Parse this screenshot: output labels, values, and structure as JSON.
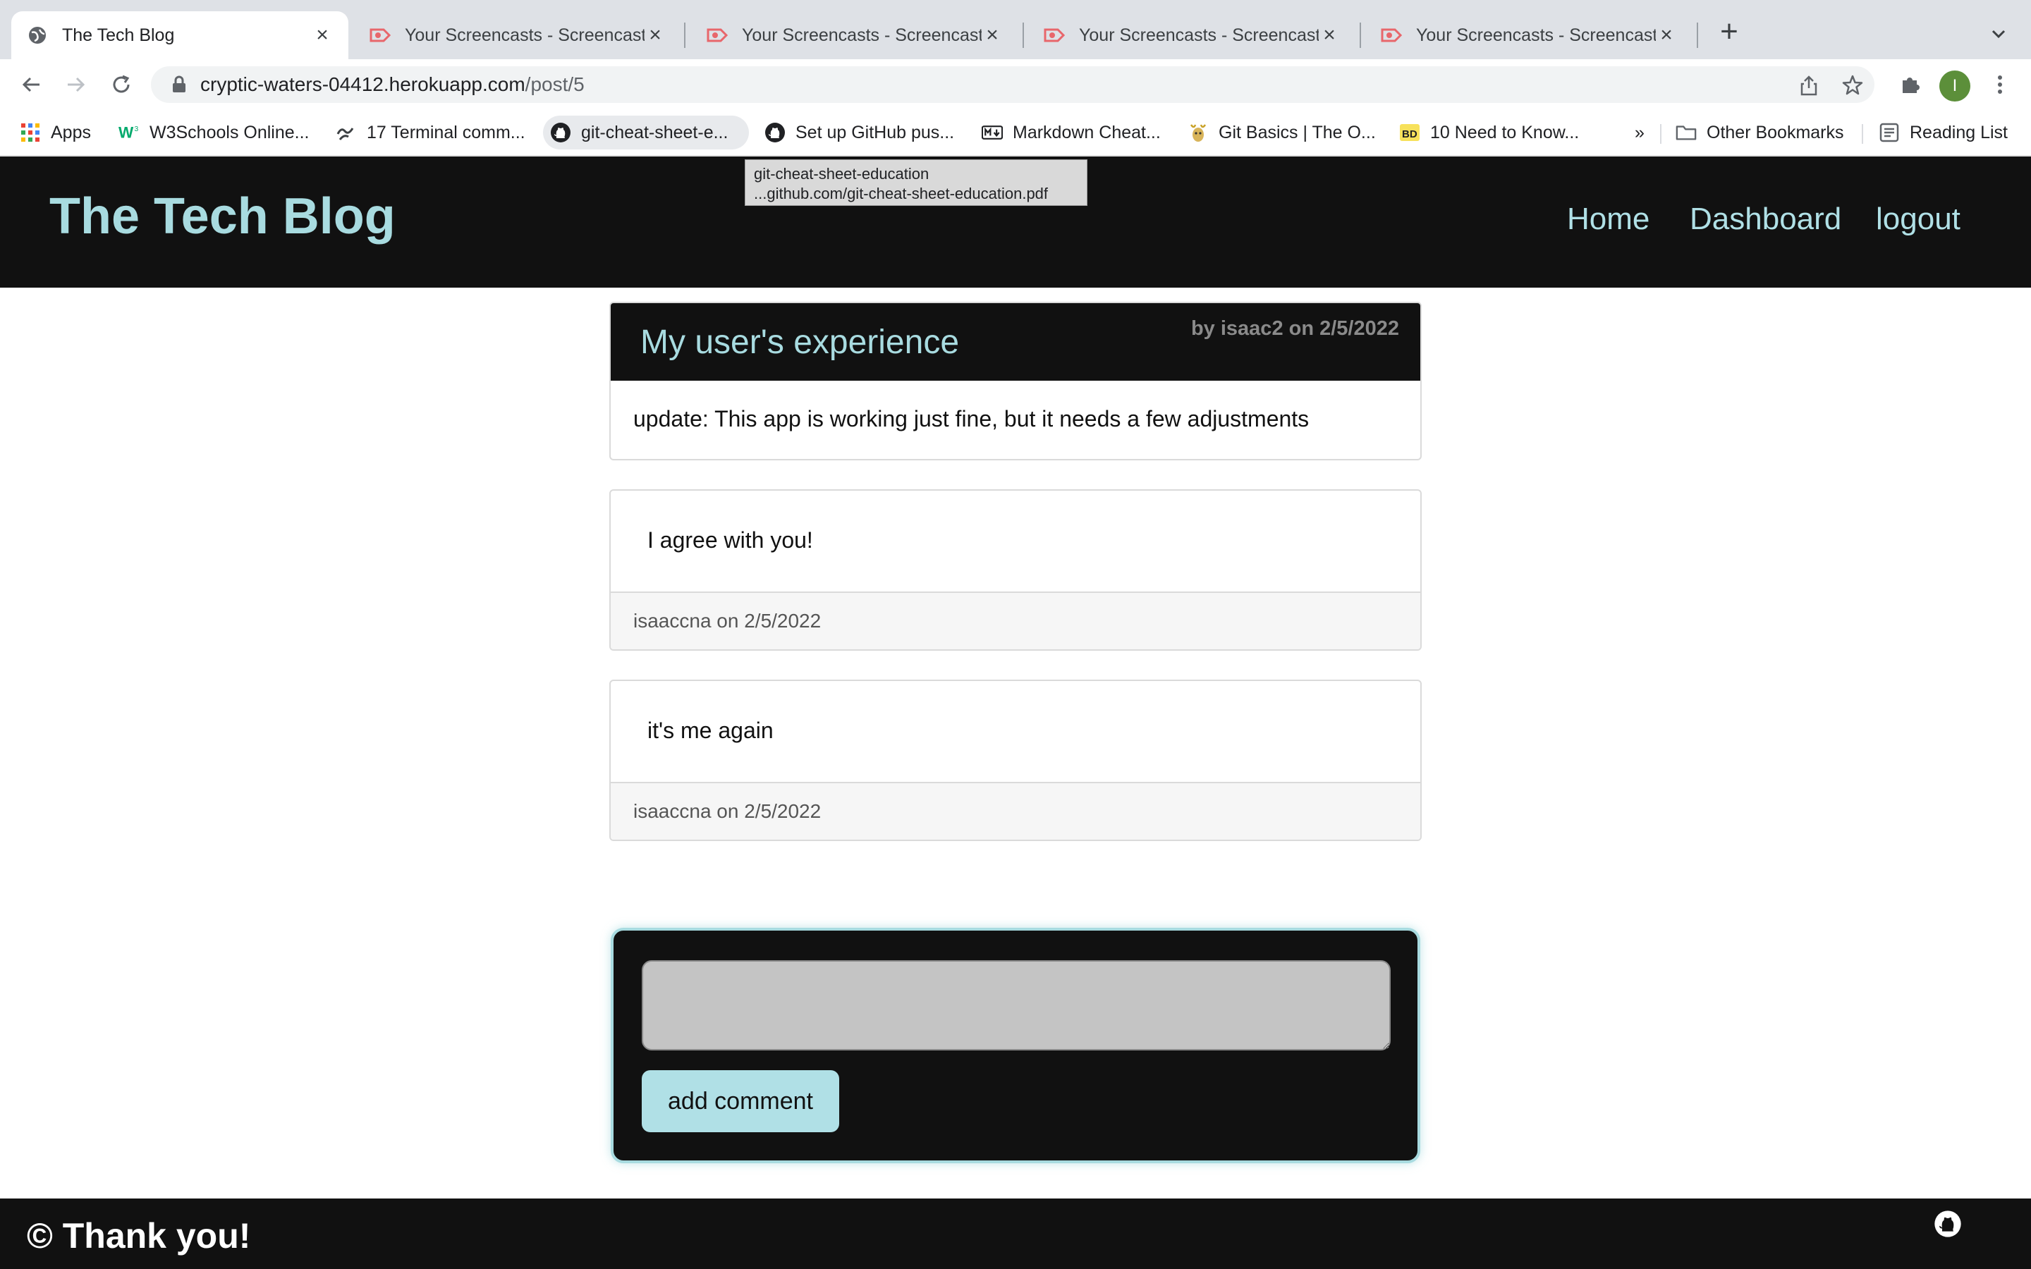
{
  "browser": {
    "tabs": [
      {
        "title": "The Tech Blog",
        "active": true
      },
      {
        "title": "Your Screencasts - Screencast-O-Matic",
        "active": false
      },
      {
        "title": "Your Screencasts - Screencast-O-Matic",
        "active": false
      },
      {
        "title": "Your Screencasts - Screencast-O-Matic",
        "active": false
      },
      {
        "title": "Your Screencasts - Screencast-O-Matic",
        "active": false
      }
    ],
    "url_host": "cryptic-waters-04412.herokuapp.com",
    "url_path": "/post/5",
    "profile_initial": "I",
    "bookmarks": [
      {
        "label": "Apps"
      },
      {
        "label": "W3Schools Online..."
      },
      {
        "label": "17 Terminal comm..."
      },
      {
        "label": "git-cheat-sheet-e..."
      },
      {
        "label": "Set up GitHub pus..."
      },
      {
        "label": "Markdown Cheat..."
      },
      {
        "label": "Git Basics | The O..."
      },
      {
        "label": "10 Need to Know..."
      }
    ],
    "bookmarks_overflow": "»",
    "other_bookmarks": "Other Bookmarks",
    "reading_list": "Reading List",
    "tooltip": {
      "line1": "git-cheat-sheet-education",
      "line2": "...github.com/git-cheat-sheet-education.pdf"
    },
    "colors": {
      "tab_strip": "#dee1e6",
      "omnibox": "#f1f3f4",
      "avatar": "#5c8f3a"
    }
  },
  "site": {
    "title": "The Tech Blog",
    "nav": [
      "Home",
      "Dashboard",
      "logout"
    ],
    "colors": {
      "header_bg": "#111111",
      "accent": "#a8dbe0",
      "button": "#b0e0e6"
    }
  },
  "post": {
    "title": "My user's experience",
    "meta": "by isaac2 on 2/5/2022",
    "body": "update: This app is working just fine, but it needs a few adjustments"
  },
  "comments": [
    {
      "text": "I agree with you!",
      "meta": "isaaccna on 2/5/2022"
    },
    {
      "text": "it's me again",
      "meta": "isaaccna on 2/5/2022"
    }
  ],
  "comment_form": {
    "value": "",
    "placeholder": "",
    "button_label": "add comment"
  },
  "footer": {
    "text": "© Thank you!",
    "icon": "github-icon"
  }
}
